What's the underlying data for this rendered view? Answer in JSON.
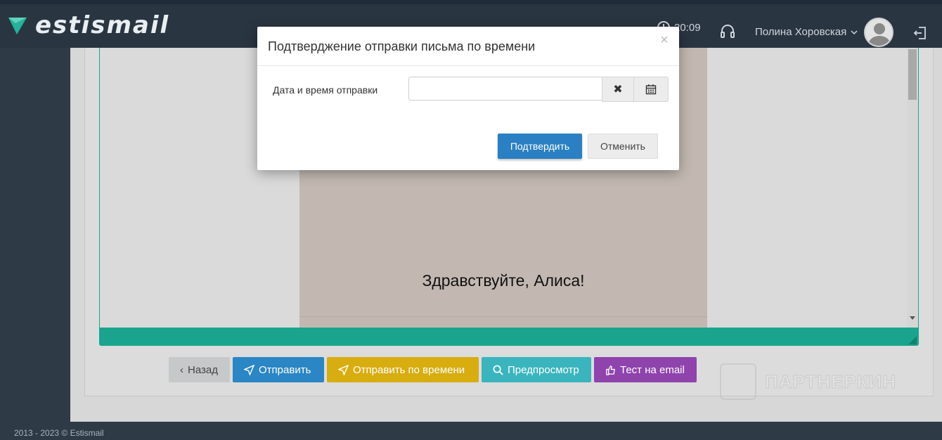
{
  "app": {
    "logo_text": "estismail",
    "brand_color": "#20a28c",
    "time": "20:09",
    "user_name": "Полина Хоровская",
    "icons": {
      "logo": "logo-mark-icon",
      "clock": "clock-icon",
      "support": "headset-icon",
      "user_menu": "chevron-down-icon",
      "logout": "logout-icon"
    }
  },
  "editor": {
    "greeting": "Здравствуйте, Алиса!"
  },
  "actions": {
    "back": "Назад",
    "send": "Отправить",
    "send_timed": "Отправить по времени",
    "preview": "Предпросмотр",
    "test_email": "Тест на email",
    "colors": {
      "back": "#c6c8ca",
      "send": "#2a86c4",
      "send_timed": "#d8ad10",
      "preview": "#3ab5bd",
      "test_email": "#8f43ad"
    }
  },
  "modal": {
    "title": "Подтверджение отправки письма по времени",
    "close": "×",
    "field_label": "Дата и время отправки",
    "field_value": "",
    "clear": "✖",
    "confirm": "Подтвердить",
    "cancel": "Отменить"
  },
  "watermark": {
    "text": "ПАРТНЕРКИН"
  },
  "footer": {
    "text": "2013 - 2023 © Estismail"
  }
}
